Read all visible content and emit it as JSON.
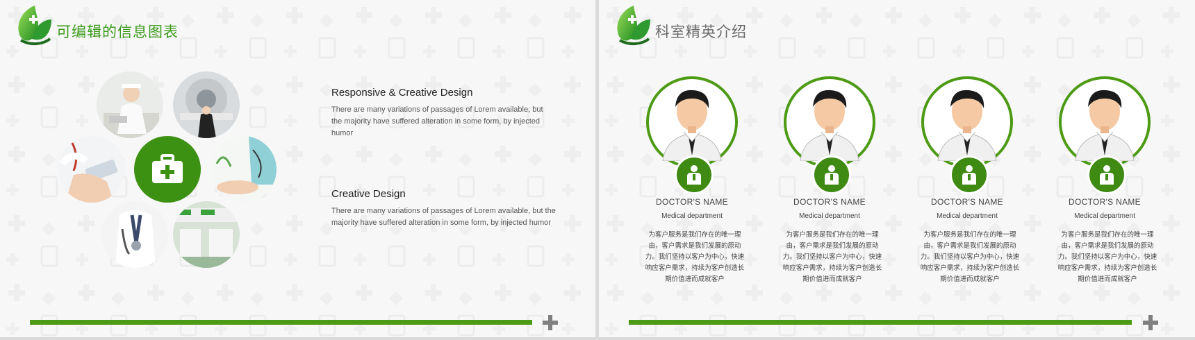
{
  "left_slide": {
    "title": "可编辑的信息图表",
    "block1": {
      "heading": "Responsive & Creative Design",
      "body": "There are many variations of passages of Lorem available, but the majority have suffered alteration in some form, by injected humor"
    },
    "block2": {
      "heading": "Creative Design",
      "body": "There are many variations of passages of Lorem available, but the majority have suffered alteration in some form, by injected humor"
    },
    "center_icon": "medical-kit-icon",
    "photos": [
      "nurse-photo",
      "scanner-photo",
      "hands-tablet-photo",
      "doctor-patient-photo",
      "stethoscope-photo",
      "lab-photo"
    ]
  },
  "right_slide": {
    "title": "科室精英介绍",
    "doctors": [
      {
        "name": "DOCTOR'S NAME",
        "department": "Medical department",
        "description": "为客户服务是我们存在的唯一理由，客户需求是我们发展的原动力。我们坚持以客户为中心，快速响应客户需求，持续为客户创造长期价值进而成就客户"
      },
      {
        "name": "DOCTOR'S NAME",
        "department": "Medical department",
        "description": "为客户服务是我们存在的唯一理由，客户需求是我们发展的原动力。我们坚持以客户为中心，快速响应客户需求，持续为客户创造长期价值进而成就客户"
      },
      {
        "name": "DOCTOR'S NAME",
        "department": "Medical department",
        "description": "为客户服务是我们存在的唯一理由，客户需求是我们发展的原动力。我们坚持以客户为中心，快速响应客户需求，持续为客户创造长期价值进而成就客户"
      },
      {
        "name": "DOCTOR'S NAME",
        "department": "Medical department",
        "description": "为客户服务是我们存在的唯一理由，客户需求是我们发展的原动力。我们坚持以客户为中心，快速响应客户需求，持续为客户创造长期价值进而成就客户"
      }
    ]
  },
  "colors": {
    "accent": "#4d9a14",
    "dark_green": "#3c9112",
    "title_green": "#3a9a1a"
  }
}
